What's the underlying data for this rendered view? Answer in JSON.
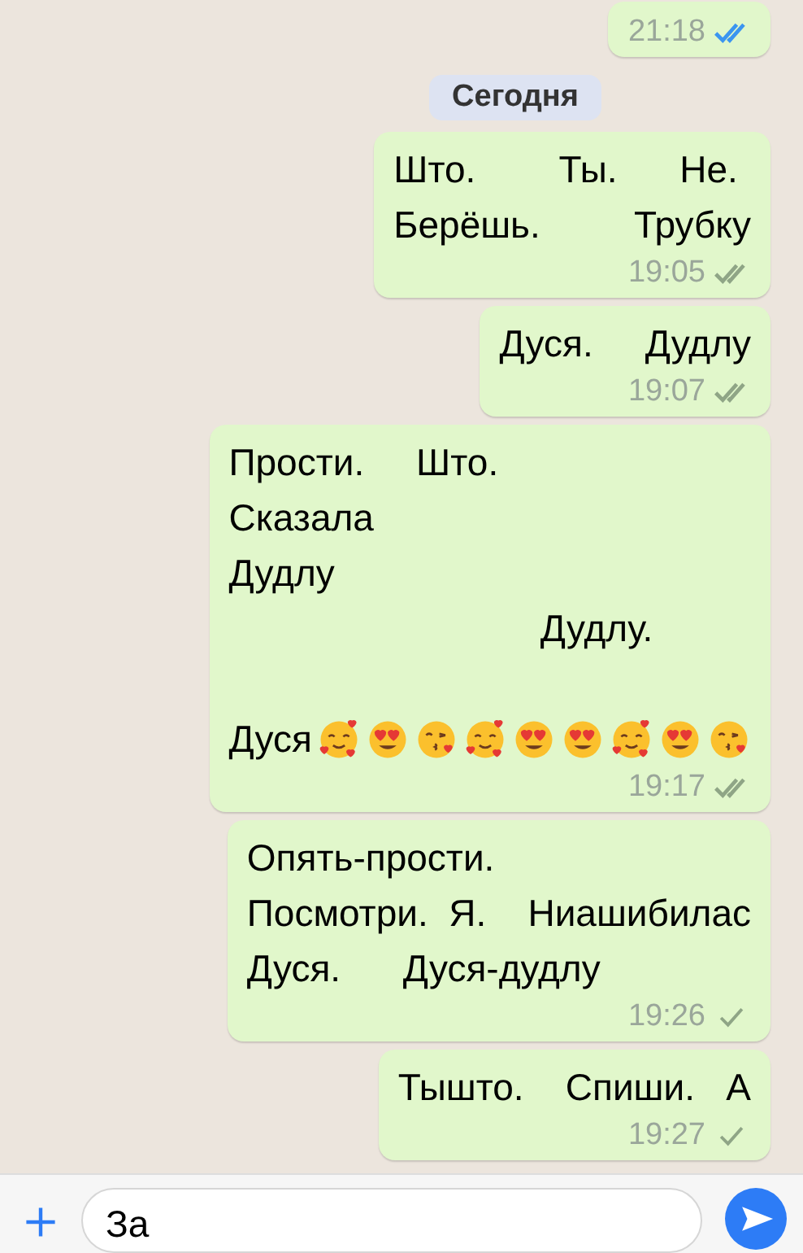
{
  "messages": [
    {
      "time": "21:18",
      "delivered": true,
      "read": true
    },
    {
      "kind": "date",
      "label": "Сегодня"
    },
    {
      "lines": [
        "Што.        Ты.      Не.",
        "Берёшь.         Трубку"
      ],
      "time": "19:05",
      "delivered": true,
      "read": false
    },
    {
      "lines": [
        "Дуся.     Дудлу"
      ],
      "time": "19:07",
      "delivered": true,
      "read": false
    },
    {
      "lines": [
        "Прости.     Што.",
        "Сказала",
        "Дудлу",
        "                              Дудлу."
      ],
      "tail_text": "Дуся",
      "emoji": [
        {
          "kind": "hearts"
        },
        {
          "kind": "heart-eyes"
        },
        {
          "kind": "kiss"
        },
        {
          "kind": "hearts"
        },
        {
          "kind": "heart-eyes"
        },
        {
          "kind": "heart-eyes"
        },
        {
          "kind": "hearts"
        },
        {
          "kind": "heart-eyes"
        },
        {
          "kind": "kiss"
        }
      ],
      "time": "19:17",
      "delivered": true,
      "read": false
    },
    {
      "lines": [
        "Опять-прости.",
        "Посмотри.  Я.    Ниашибилас",
        "Дуся.      Дуся-дудлу"
      ],
      "time": "19:26",
      "delivered": false
    },
    {
      "lines": [
        "Тышто.    Спиши.   А"
      ],
      "time": "19:27",
      "delivered": false
    }
  ],
  "composer": {
    "value": "За"
  }
}
